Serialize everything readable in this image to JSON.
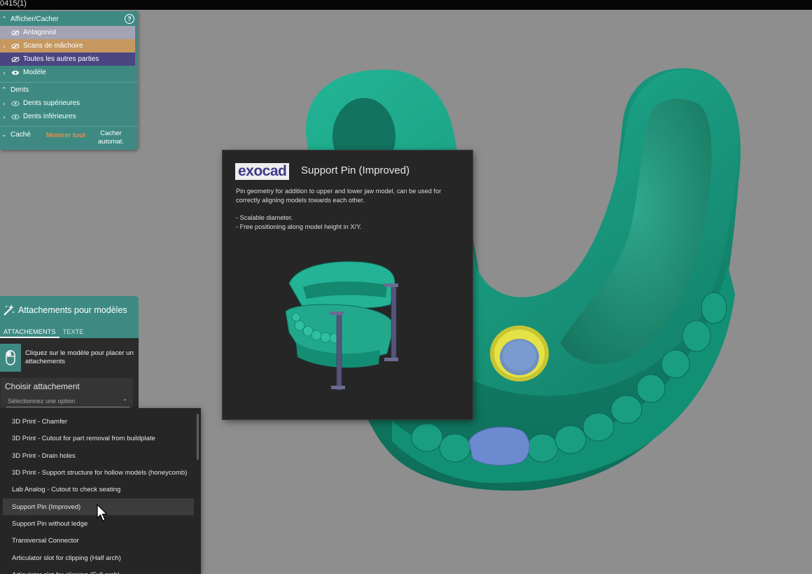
{
  "window": {
    "title": "0415(1)"
  },
  "visibility_panel": {
    "header": {
      "label": "Afficher/Cacher",
      "help": "?"
    },
    "rows": [
      {
        "label": "Antagonist",
        "color": "#a3a3b4",
        "eye": "eye-slash-icon"
      },
      {
        "label": "Scans de mâchoire",
        "color": "#c6985f",
        "eye": "eye-slash-icon"
      },
      {
        "label": "Toutes les autres parties",
        "color": "#4b4682",
        "eye": "eye-slash-icon"
      },
      {
        "label": "Modèle",
        "eye": "eye-icon"
      }
    ],
    "teeth_section": {
      "label": "Dents"
    },
    "teeth_rows": [
      {
        "label": "Dents supérieures",
        "eye": "eye-icon"
      },
      {
        "label": "Dents inférieures",
        "eye": "eye-icon"
      }
    ],
    "footer": {
      "hidden_label": "Caché",
      "show_all_label": "Montrer tout",
      "auto_hide_line1": "Cacher",
      "auto_hide_line2": "automat."
    }
  },
  "attachments_panel": {
    "title": "Attachements pour modèles",
    "tabs": [
      "ATTACHEMENTS",
      "TEXTE"
    ],
    "active_tab": "ATTACHEMENTS",
    "hint_line1": "Cliquez sur le modèle pour placer un",
    "hint_line2": "attachements",
    "choose_label": "Choisir attachement",
    "select_placeholder": "Sélectionnez une option"
  },
  "dropdown": {
    "options": [
      "3D Print - Chamfer",
      "3D Print - Cutout for part removal from buildplate",
      "3D Print - Drain holes",
      "3D Print - Support structure for hollow models (honeycomb)",
      "Lab Analog - Cutout to check seating",
      "Support Pin (Improved)",
      "Support Pin without ledge",
      "Transversal Connector",
      "Articulator slot for clipping (Half arch)",
      "Articulator slot for clipping (Full arch)"
    ],
    "hovered": "Support Pin (Improved)"
  },
  "tooltip": {
    "brand": "exocad",
    "title": "Support Pin (Improved)",
    "description_line1": "Pin geometry for addition to upper and lower jaw model, can be used for",
    "description_line2": "correctly aligning models towards each other.",
    "bullet1": "- Scalable diameter.",
    "bullet2": "- Free positioning along model height in X/Y."
  },
  "colors": {
    "accent": "#3e8a83",
    "model": "#1aa58a",
    "pin_ring": "#d8d53a",
    "pin_core": "#6f8fc0",
    "background": "#8e8e8e",
    "brand_text": "#3e3b8a",
    "highlight_text": "#e0914e"
  }
}
